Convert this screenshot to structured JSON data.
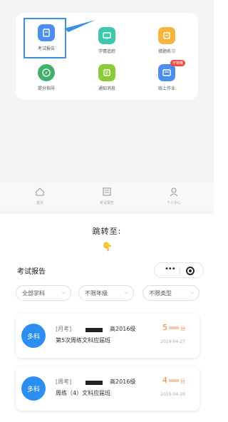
{
  "grid": {
    "items": [
      {
        "label": "考试报告",
        "color": "#4a8ff0",
        "icon": "report-icon"
      },
      {
        "label": "学情追踪",
        "color": "#3fc8b0",
        "icon": "track-icon"
      },
      {
        "label": "错题练习",
        "color": "#f5b53f",
        "icon": "practice-icon"
      },
      {
        "label": "提分指导",
        "color": "#40b06a",
        "icon": "compass-icon"
      },
      {
        "label": "通知消息",
        "color": "#8acb3a",
        "icon": "message-icon"
      },
      {
        "label": "线上作业",
        "color": "#4a8ff0",
        "icon": "homework-icon",
        "badge": "不错哦"
      }
    ]
  },
  "tabbar": {
    "tabs": [
      {
        "label": "首页",
        "icon": "home-icon"
      },
      {
        "label": "考试报告",
        "icon": "report-tab-icon"
      },
      {
        "label": "个人中心",
        "icon": "user-icon"
      }
    ]
  },
  "jump_text": "跳转至:",
  "hand_emoji": "👇",
  "panel": {
    "title": "考试报告",
    "capsule_dots": "•••"
  },
  "filters": [
    {
      "label": "全部学科"
    },
    {
      "label": "不限年级"
    },
    {
      "label": "不限类型"
    }
  ],
  "reports": [
    {
      "avatar": "多科",
      "type": "[月考]",
      "grade": "高2016级",
      "name": "第5次周练文科应届班",
      "score": "5",
      "unit": "分",
      "date": "2019-04-27"
    },
    {
      "avatar": "多科",
      "type": "[周考]",
      "grade": "高2016级",
      "name": "周练（4）文科应届班",
      "score": "4",
      "unit": "分",
      "date": "2019-04-19"
    }
  ],
  "colors": {
    "accent": "#3d8fe8",
    "score": "#f07c3a",
    "badge": "#ef4d3f"
  }
}
